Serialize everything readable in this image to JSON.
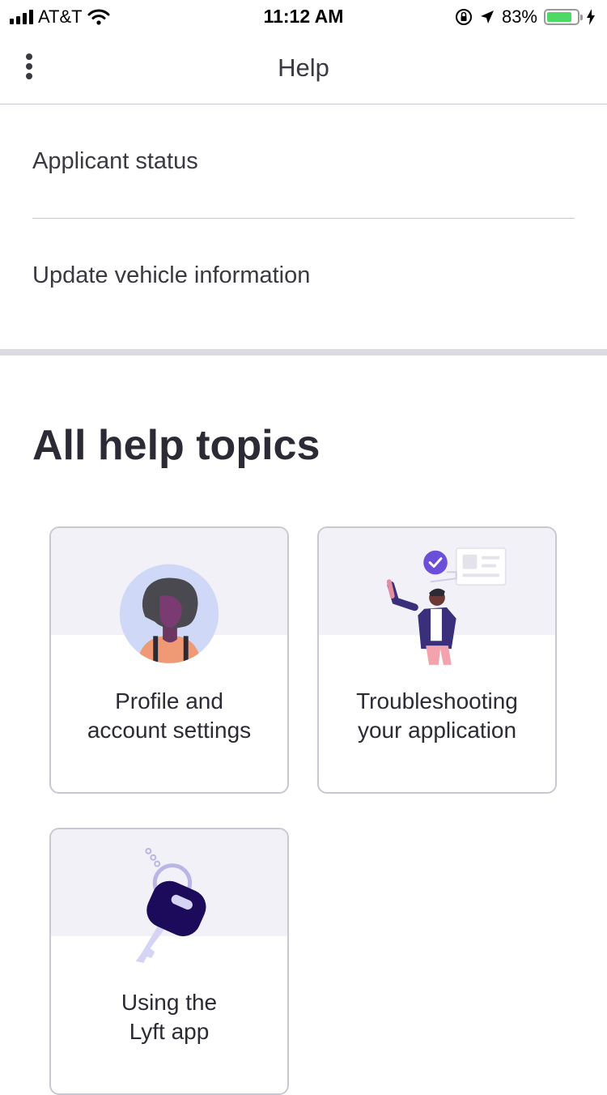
{
  "status_bar": {
    "carrier": "AT&T",
    "time": "11:12 AM",
    "battery_percent": "83%",
    "battery_level": 0.83
  },
  "header": {
    "title": "Help",
    "menu_icon": "more-vertical-icon"
  },
  "quick_links": [
    {
      "label": "Applicant status"
    },
    {
      "label": "Update vehicle information"
    }
  ],
  "section": {
    "title": "All help topics"
  },
  "topics": [
    {
      "line1": "Profile and",
      "line2": "account settings",
      "icon": "avatar-illustration"
    },
    {
      "line1": "Troubleshooting",
      "line2": "your application",
      "icon": "approval-illustration"
    },
    {
      "line1": "Using the",
      "line2": "Lyft app",
      "icon": "car-key-illustration"
    }
  ],
  "colors": {
    "accent_purple": "#6b4fd8",
    "card_band": "#f2f1f8",
    "divider": "#c9c8d0",
    "key_navy": "#1c0a5a",
    "battery_green": "#4cd964"
  }
}
